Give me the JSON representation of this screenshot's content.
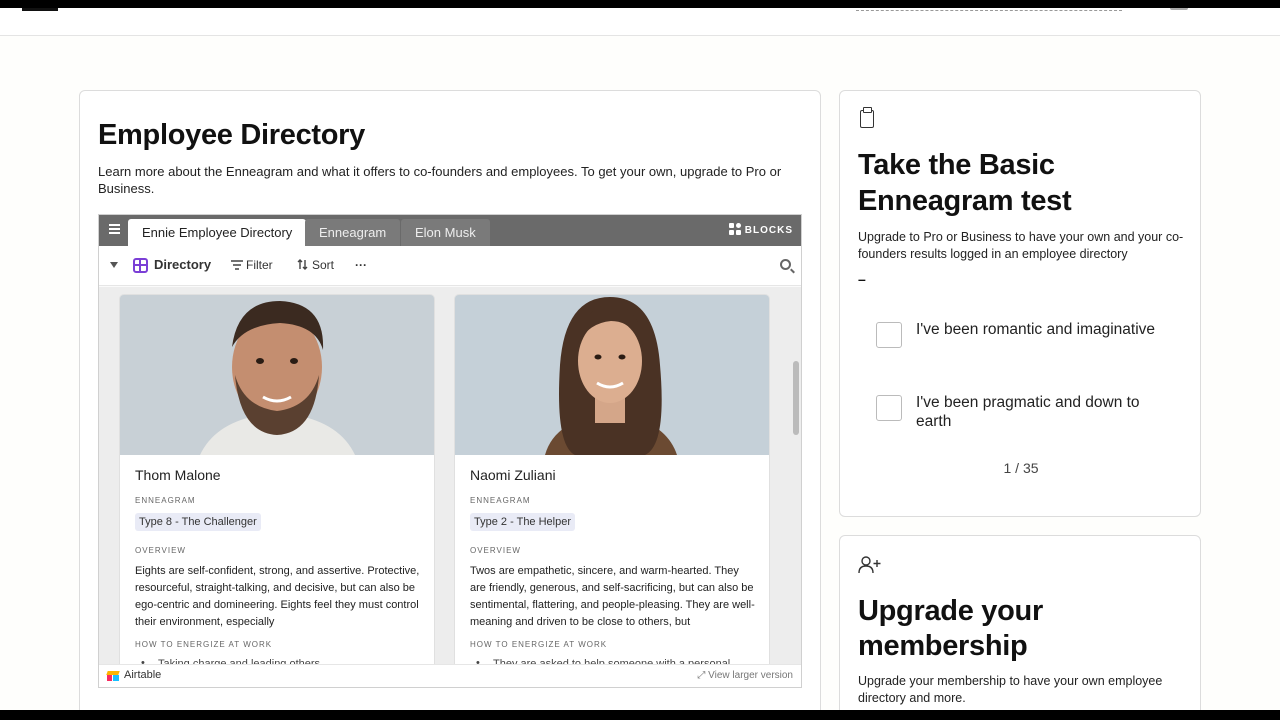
{
  "main": {
    "title": "Employee Directory",
    "description": "Learn more about the Enneagram and what it offers to co-founders and employees. To get your own, upgrade to Pro or Business."
  },
  "embed": {
    "tabs": [
      "Ennie Employee Directory",
      "Enneagram",
      "Elon Musk"
    ],
    "blocks_label": "BLOCKS",
    "view_name": "Directory",
    "filter_label": "Filter",
    "sort_label": "Sort",
    "more_label": "···",
    "footer_brand": "Airtable",
    "view_larger": "View larger version",
    "field_labels": {
      "enneagram": "ENNEAGRAM",
      "overview": "OVERVIEW",
      "energize": "HOW TO ENERGIZE AT WORK"
    },
    "records": [
      {
        "name": "Thom Malone",
        "type": "Type 8 - The Challenger",
        "overview": "Eights are self-confident, strong, and assertive. Protective, resourceful, straight-talking, and decisive, but can also be ego-centric and domineering. Eights feel they must control their environment, especially",
        "energize_first": "Taking charge and leading others"
      },
      {
        "name": "Naomi Zuliani",
        "type": "Type 2 - The Helper",
        "overview": "Twos are empathetic, sincere, and warm-hearted. They are friendly, generous, and self-sacrificing, but can also be sentimental, flattering, and people-pleasing. They are well-meaning and driven to be close to others, but",
        "energize_first": "They are asked to help someone with a personal"
      }
    ]
  },
  "test": {
    "title": "Take the Basic Enneagram test",
    "description": "Upgrade to Pro or Business to have your own and your co-founders results logged in an employee directory",
    "dash": "–",
    "options": [
      "I've been romantic and imaginative",
      "I've been pragmatic and down to earth"
    ],
    "counter": "1 / 35"
  },
  "upgrade": {
    "title": "Upgrade your membership",
    "description": "Upgrade your membership to have your own employee directory and more."
  },
  "colors": {
    "accent_purple": "#7b3fd6",
    "tabbar": "#6a6a6a",
    "pill": "#e9ebf6"
  },
  "icons": [
    "menu-icon",
    "blocks-icon",
    "grid-icon",
    "filter-icon",
    "sort-icon",
    "search-icon",
    "clipboard-icon",
    "add-user-icon",
    "expand-icon",
    "airtable-logo"
  ]
}
